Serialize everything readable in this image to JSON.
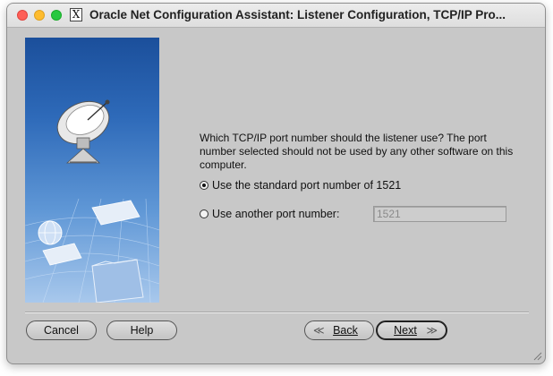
{
  "window": {
    "title": "Oracle Net Configuration Assistant: Listener Configuration, TCP/IP Pro...",
    "x_icon_label": "X"
  },
  "main": {
    "prompt": "Which TCP/IP port number should the listener use? The port number selected should not be used by any other software on this computer.",
    "options": [
      {
        "label": "Use the standard port number of 1521",
        "selected": true
      },
      {
        "label": "Use another port number:",
        "selected": false
      }
    ],
    "port_field": {
      "value": "1521",
      "enabled": false
    }
  },
  "buttons": {
    "cancel": "Cancel",
    "help": "Help",
    "back": "Back",
    "next": "Next"
  },
  "colors": {
    "window_bg": "#c8c8c8",
    "side_panel_top": "#1b4f9b",
    "side_panel_bottom": "#a8c8ec",
    "close": "#fe5f57",
    "minimize": "#febc2e",
    "maximize": "#28c840"
  },
  "icons": {
    "side_panel": [
      "satellite-dish-icon",
      "globe-icon",
      "document-icon",
      "folder-icon"
    ],
    "back_arrow": "chevron-left-icon",
    "next_arrow": "chevron-right-icon"
  }
}
